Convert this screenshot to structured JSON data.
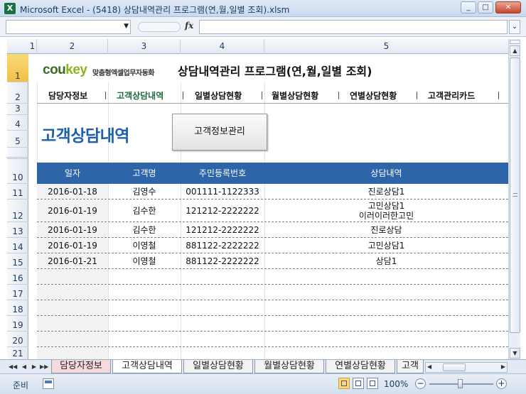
{
  "window": {
    "title": "Microsoft Excel - (5418) 상담내역관리 프로그램(연,월,일별 조회).xlsm",
    "icon": "excel-icon",
    "minimize": "_",
    "restore": "□",
    "close": "✕"
  },
  "formula_bar": {
    "name_box_value": "",
    "fx_label": "fx",
    "formula_value": ""
  },
  "columns": [
    "1",
    "2",
    "3",
    "4",
    "5"
  ],
  "rows": [
    "1",
    "2",
    "3",
    "4",
    "5",
    "10",
    "11",
    "12",
    "13",
    "14",
    "15",
    "16",
    "17",
    "18",
    "19",
    "20",
    "21"
  ],
  "selected_row": "1",
  "logo": {
    "brand_a": "cou",
    "brand_b": "key",
    "tagline": "맞춤형엑셀업무자동화"
  },
  "app_title": "상담내역관리 프로그램(연,월,일별 조회)",
  "nav": {
    "items": [
      "담당자정보",
      "고객상담내역",
      "일별상담현황",
      "월별상담현황",
      "연별상담현황",
      "고객관리카드"
    ],
    "active_index": 1
  },
  "page_title": "고객상담내역",
  "customer_info_button": "고객정보관리",
  "table": {
    "headers": {
      "date": "일자",
      "name": "고객명",
      "rrn": "주민등록번호",
      "detail": "상담내역"
    },
    "rows": [
      {
        "date": "2016-01-18",
        "name": "김영수",
        "rrn": "001111-1122333",
        "detail": [
          "진로상담1"
        ]
      },
      {
        "date": "2016-01-19",
        "name": "김수한",
        "rrn": "121212-2222222",
        "detail": [
          "고민상담1",
          "이러이러한고민"
        ]
      },
      {
        "date": "2016-01-19",
        "name": "김수한",
        "rrn": "121212-2222222",
        "detail": [
          "진로상담"
        ]
      },
      {
        "date": "2016-01-19",
        "name": "이영철",
        "rrn": "881122-2222222",
        "detail": [
          "고민상담1"
        ]
      },
      {
        "date": "2016-01-21",
        "name": "이영철",
        "rrn": "881122-2222222",
        "detail": [
          "상담1"
        ]
      }
    ]
  },
  "sheet_tabs": {
    "items": [
      "담당자정보",
      "고객상담내역",
      "일별상담현황",
      "월별상담현황",
      "연별상담현황",
      "고객"
    ],
    "active_index": 1
  },
  "status_bar": {
    "ready": "준비",
    "zoom": "100%",
    "zoom_out": "−",
    "zoom_in": "+"
  },
  "colors": {
    "table_header": "#2e64a8",
    "page_title": "#1e5fb0",
    "active_nav": "#1a6a3a",
    "selected_row_header": "#f1c046"
  }
}
